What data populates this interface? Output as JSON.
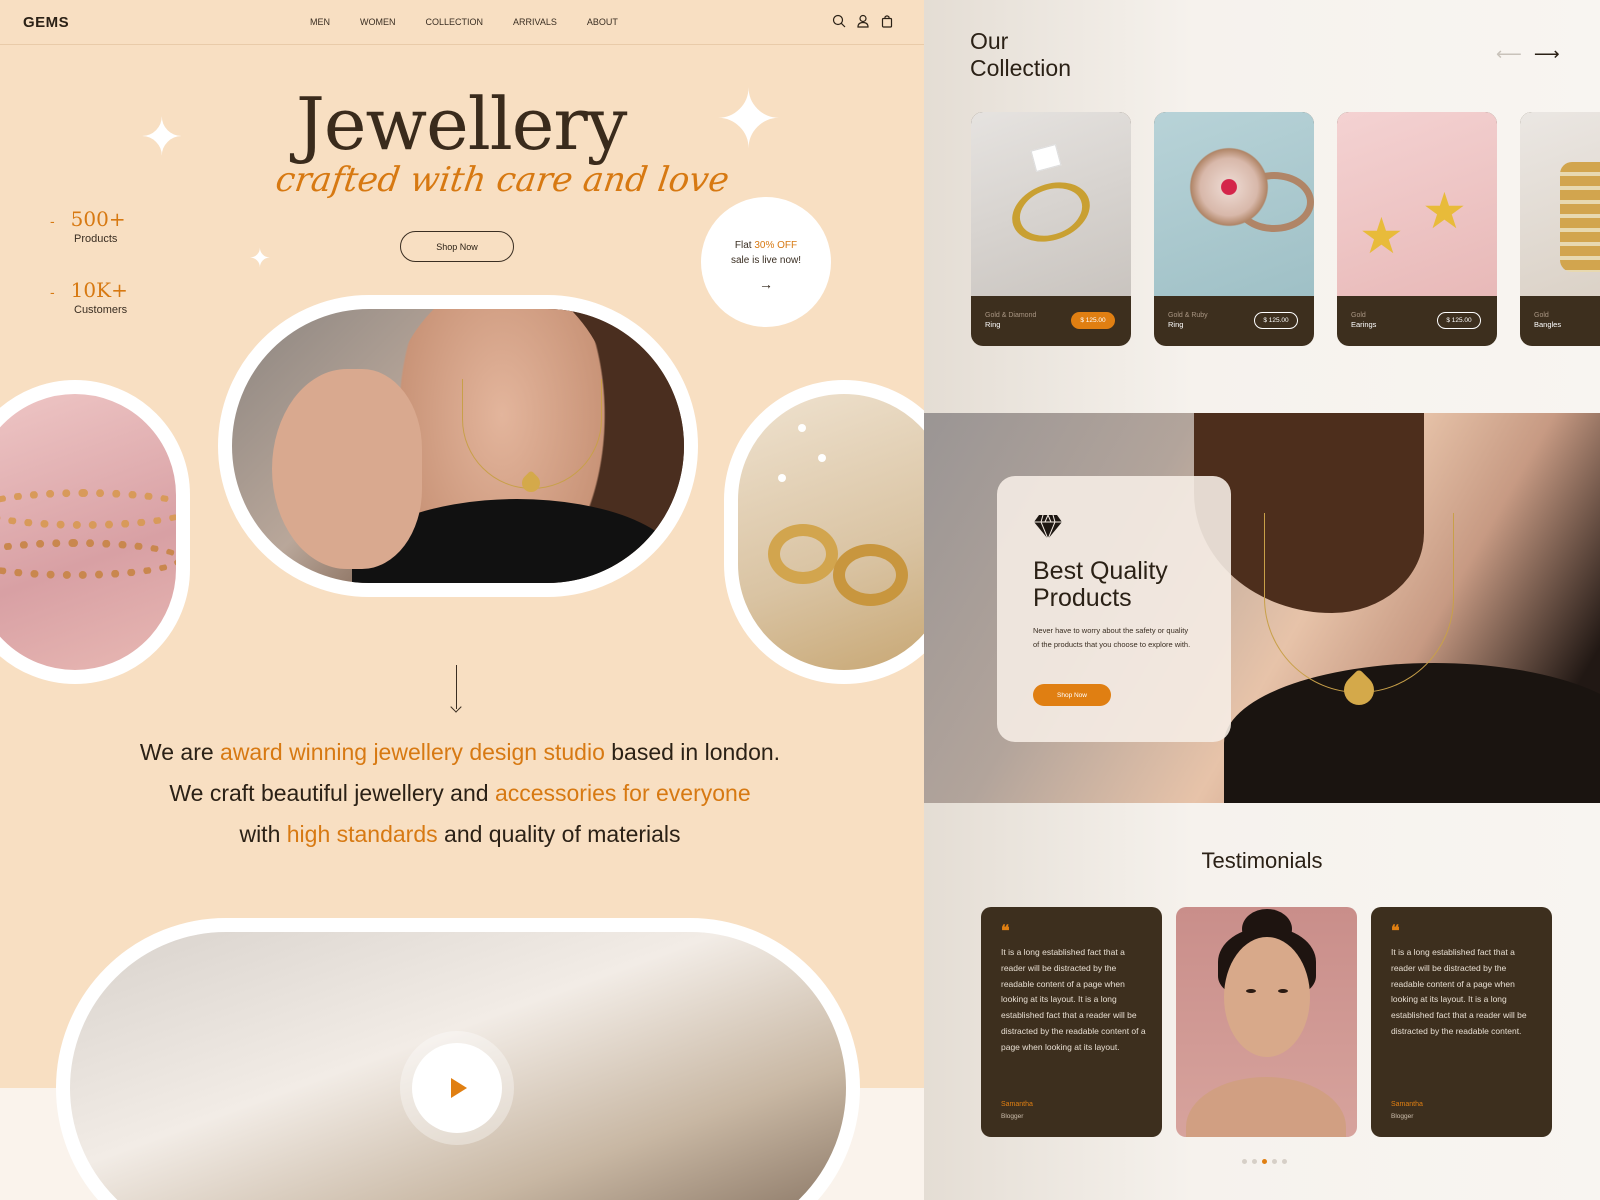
{
  "nav": {
    "logo": "GEMS",
    "links": [
      "MEN",
      "WOMEN",
      "COLLECTION",
      "ARRIVALS",
      "ABOUT"
    ],
    "icons": [
      "search-icon",
      "user-icon",
      "bag-icon"
    ]
  },
  "hero": {
    "title": "Jewellery",
    "subtitle": "crafted with care and love",
    "shop_button": "Shop Now",
    "stats": [
      {
        "value": "500+",
        "label": "Products"
      },
      {
        "value": "10K+",
        "label": "Customers"
      }
    ],
    "sale": {
      "prefix": "Flat ",
      "highlight": "30% OFF",
      "line2": "sale is live now!",
      "arrow": "→"
    }
  },
  "about": {
    "line1_a": "We are ",
    "line1_hl": "award winning jewellery design studio",
    "line1_b": " based in london.",
    "line2_a": "We craft beautiful jewellery and ",
    "line2_hl": "accessories for everyone",
    "line3_a": "with ",
    "line3_hl": "high standards",
    "line3_b": " and quality of materials"
  },
  "collection": {
    "title_line1": "Our",
    "title_line2": "Collection",
    "prev_arrow": "⟵",
    "next_arrow": "⟶",
    "cards": [
      {
        "category": "Gold & Diamond",
        "name": "Ring",
        "price": "$ 125.00",
        "active": true
      },
      {
        "category": "Gold & Ruby",
        "name": "Ring",
        "price": "$ 125.00",
        "active": false
      },
      {
        "category": "Gold",
        "name": "Earings",
        "price": "$ 125.00",
        "active": false
      },
      {
        "category": "Gold",
        "name": "Bangles",
        "price": "",
        "active": false
      }
    ]
  },
  "quality": {
    "title_line1": "Best Quality",
    "title_line2": "Products",
    "text": "Never have to worry about the safety or quality of the products that you choose to explore with.",
    "button": "Shop Now"
  },
  "testimonials": {
    "title": "Testimonials",
    "quote_mark": "❝",
    "items": [
      {
        "text": "It is a long established fact that a reader will be distracted by the readable content of a page when looking at its layout. It is a long established fact that a reader will be distracted by the readable content of a page when looking at its layout.",
        "name": "Samantha",
        "role": "Blogger"
      },
      {
        "text": "It is a long established fact that a reader will be distracted by the readable content of a page when looking at its layout. It is a long established fact that a reader will be distracted by the readable content.",
        "name": "Samantha",
        "role": "Blogger"
      }
    ],
    "dots": 5,
    "active_dot": 2
  },
  "colors": {
    "accent": "#e07f12",
    "hero_bg": "#f8dfc2",
    "card_dark": "#3d2f1e"
  }
}
